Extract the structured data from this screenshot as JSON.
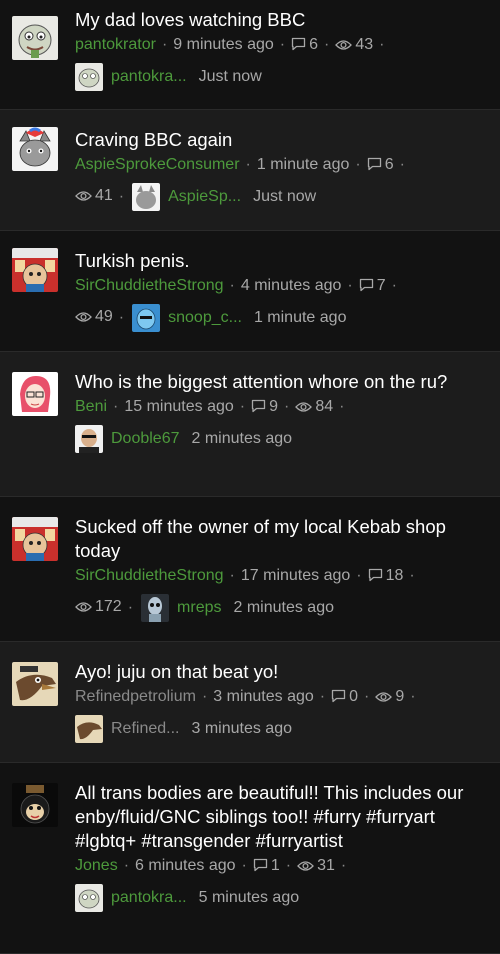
{
  "threads": [
    {
      "title": "My dad loves watching BBC",
      "author": "pantokrator",
      "time": "9 minutes ago",
      "replies": "6",
      "views": "43",
      "last_user": "pantokra...",
      "last_time": "Just now",
      "avatar": "pepe-avatar"
    },
    {
      "title": "Craving BBC again",
      "author": "AspieSprokeConsumer",
      "time": "1 minute ago",
      "replies": "6",
      "views": "41",
      "last_user": "AspieSp...",
      "last_time": "Just now",
      "avatar": "cat-avatar"
    },
    {
      "title": "Turkish penis.",
      "author": "SirChuddietheStrong",
      "time": "4 minutes ago",
      "replies": "7",
      "views": "49",
      "last_user": "snoop_c...",
      "last_time": "1 minute ago",
      "avatar": "cartoon-avatar"
    },
    {
      "title": "Who is the biggest attention whore on the ru?",
      "author": "Beni",
      "time": "15 minutes ago",
      "replies": "9",
      "views": "84",
      "last_user": "Dooble67",
      "last_time": "2 minutes ago",
      "avatar": "anime-avatar"
    },
    {
      "title": "Sucked off the owner of my local Kebab shop today",
      "author": "SirChuddietheStrong",
      "time": "17 minutes ago",
      "replies": "18",
      "views": "172",
      "last_user": "mreps",
      "last_time": "2 minutes ago",
      "avatar": "cartoon-avatar"
    },
    {
      "title": "Ayo! juju on that beat yo!",
      "author": "Refinedpetrolium",
      "time": "3 minutes ago",
      "replies": "0",
      "views": "9",
      "last_user": "Refined...",
      "last_time": "3 minutes ago",
      "avatar": "bird-avatar"
    },
    {
      "title": "All trans bodies are beautiful!! This includes our enby/fluid/GNC siblings too!! #furry #furryart #lgbtq+ #transgender #furryartist",
      "author": "Jones",
      "time": "6 minutes ago",
      "replies": "1",
      "views": "31",
      "last_user": "pantokra...",
      "last_time": "5 minutes ago",
      "avatar": "monkey-avatar"
    }
  ],
  "colors": {
    "background": "#161616",
    "author_green": "#4d9a3c",
    "author_grey": "#8a8a8a",
    "meta": "#a8a8a8"
  }
}
